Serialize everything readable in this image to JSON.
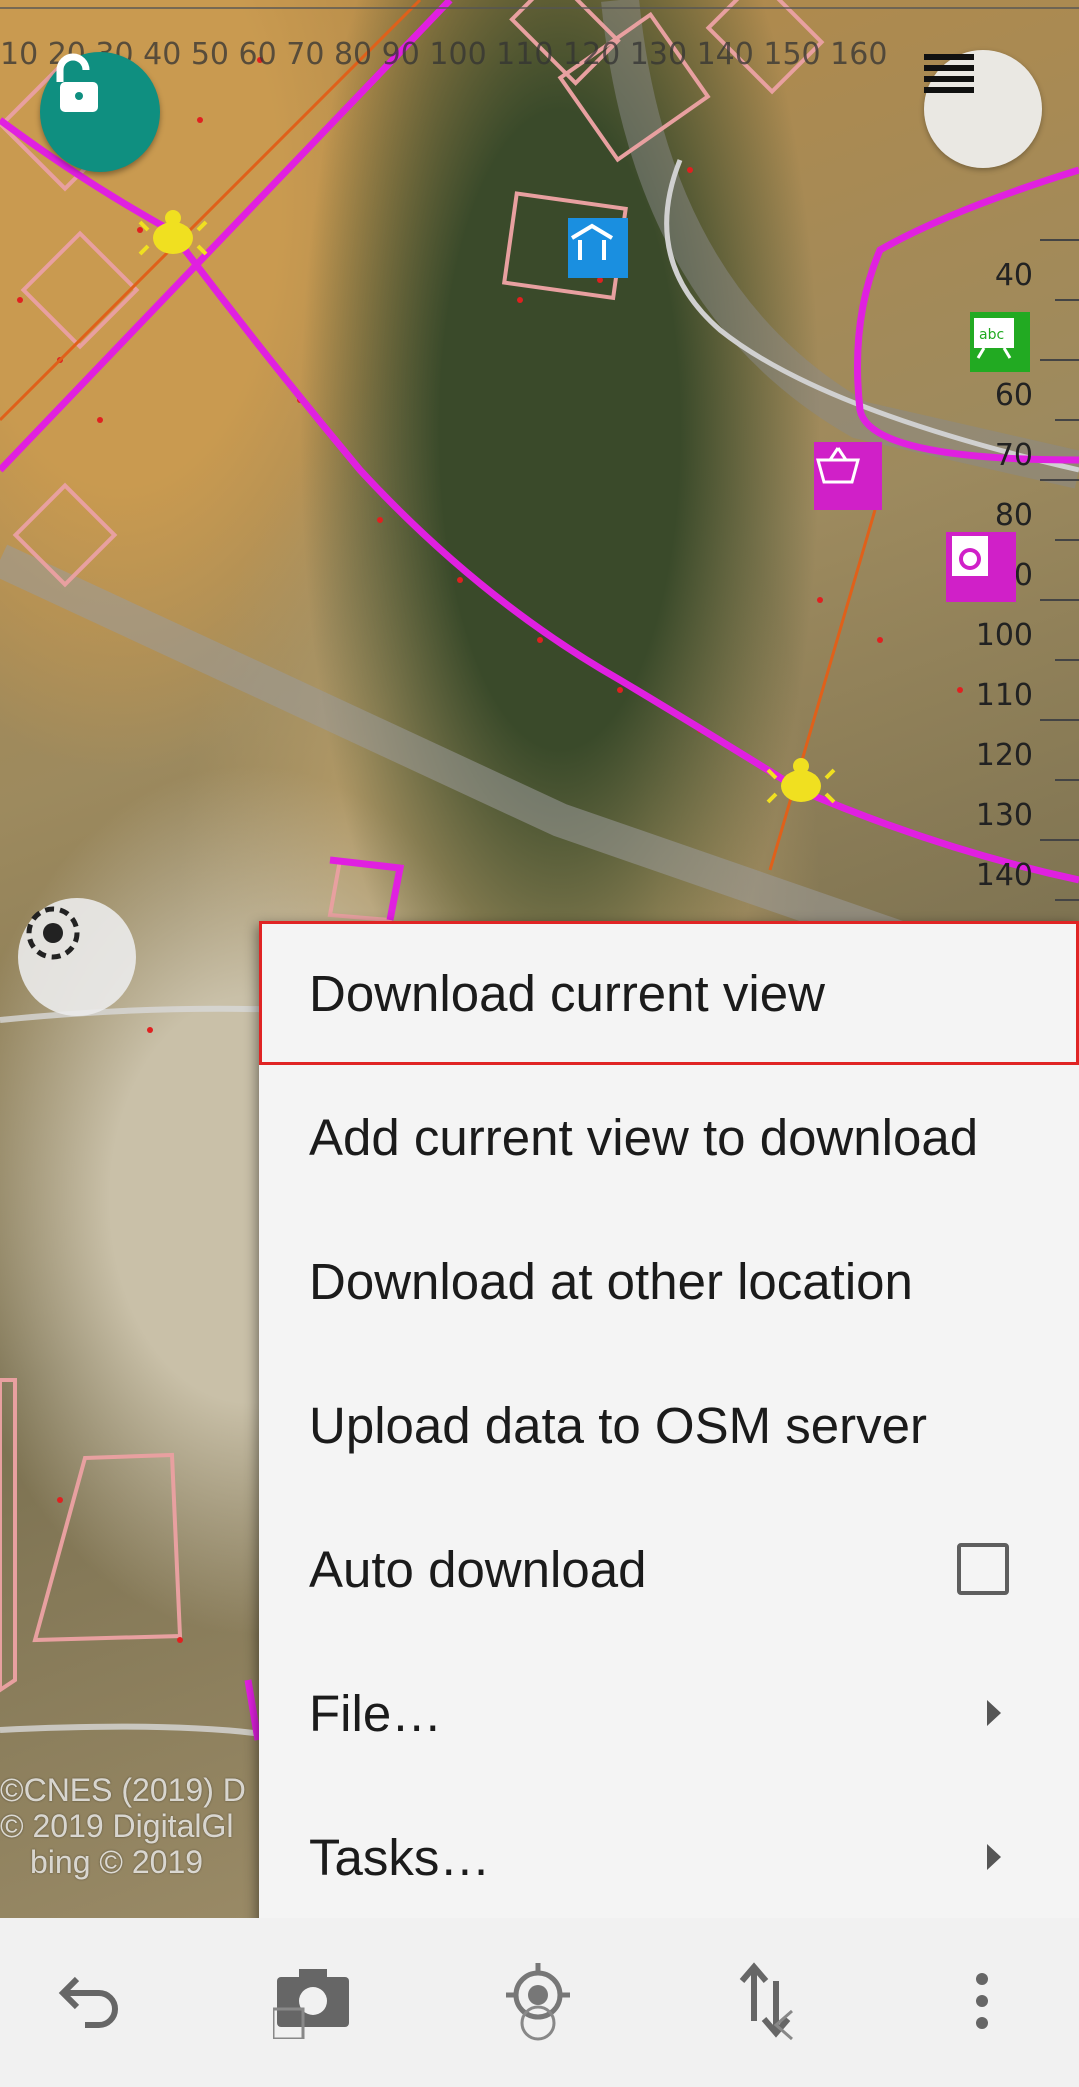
{
  "map": {
    "scale_labels": [
      "40",
      "60",
      "70",
      "80",
      "90",
      "100",
      "110",
      "120",
      "130",
      "140"
    ],
    "top_ruler_text": "10 20 30 40 50 60 70 80 90 100 110 120 130 140 150 160",
    "attribution": [
      "©CNES (2019) D",
      "© 2019 DigitalGl",
      "bing © 2019"
    ],
    "colors": {
      "road": "#e020e0",
      "poi_bg": "#d020c8",
      "lock": "#0f8f80"
    }
  },
  "controls": {
    "lock_icon": "unlocked-padlock-icon",
    "layers_icon": "hamburger-menu-icon",
    "gps_icon": "gps-target-icon"
  },
  "menu": {
    "items": [
      {
        "label": "Download current view",
        "type": "action",
        "highlighted": true
      },
      {
        "label": "Add current view to download",
        "type": "action"
      },
      {
        "label": "Download at other location",
        "type": "action"
      },
      {
        "label": "Upload data to OSM server",
        "type": "action"
      },
      {
        "label": "Auto download",
        "type": "checkbox",
        "checked": false
      },
      {
        "label": "File…",
        "type": "submenu"
      },
      {
        "label": "Tasks…",
        "type": "submenu"
      }
    ]
  },
  "bottom_bar": {
    "icons": [
      "undo-icon",
      "camera-icon",
      "gps-follow-icon",
      "transfer-icon",
      "overflow-menu-icon"
    ]
  }
}
